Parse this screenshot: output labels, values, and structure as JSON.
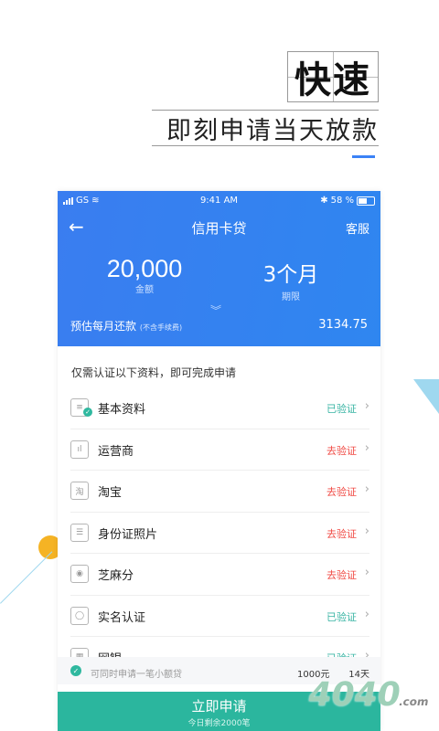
{
  "promo": {
    "title": "快速",
    "subtitle": "即刻申请当天放款"
  },
  "status_bar": {
    "carrier": "GS",
    "time": "9:41 AM",
    "battery": "58 %"
  },
  "nav": {
    "title": "信用卡贷",
    "service": "客服"
  },
  "loan": {
    "amount": "20,000",
    "amount_label": "金额",
    "term": "3个月",
    "term_label": "期限",
    "monthly_label": "预估每月还款",
    "monthly_note": "(不含手续费)",
    "monthly_value": "3134.75"
  },
  "requirements_title": "仅需认证以下资料，即可完成申请",
  "requirements": [
    {
      "label": "基本资料",
      "status": "已验证",
      "state": "ok",
      "icon": "profile-icon"
    },
    {
      "label": "运营商",
      "status": "去验证",
      "state": "todo",
      "icon": "carrier-icon"
    },
    {
      "label": "淘宝",
      "status": "去验证",
      "state": "todo",
      "icon": "taobao-icon"
    },
    {
      "label": "身份证照片",
      "status": "去验证",
      "state": "todo",
      "icon": "id-card-icon"
    },
    {
      "label": "芝麻分",
      "status": "去验证",
      "state": "todo",
      "icon": "sesame-icon"
    },
    {
      "label": "实名认证",
      "status": "已验证",
      "state": "ok",
      "icon": "person-icon"
    },
    {
      "label": "网银",
      "status": "已验证",
      "state": "ok",
      "icon": "bank-icon"
    }
  ],
  "small_loan": {
    "text": "可同时申请一笔小额贷",
    "amount": "1000元",
    "days": "14天"
  },
  "apply": {
    "label": "立即申请",
    "sub": "今日剩余2000笔"
  },
  "watermark": {
    "text": "4040",
    "suffix": ".com"
  },
  "colors": {
    "primary_blue": "#3a7df0",
    "verified_green": "#3ab5a4",
    "todo_red": "#f04a44",
    "apply_green": "#2bb69e"
  }
}
